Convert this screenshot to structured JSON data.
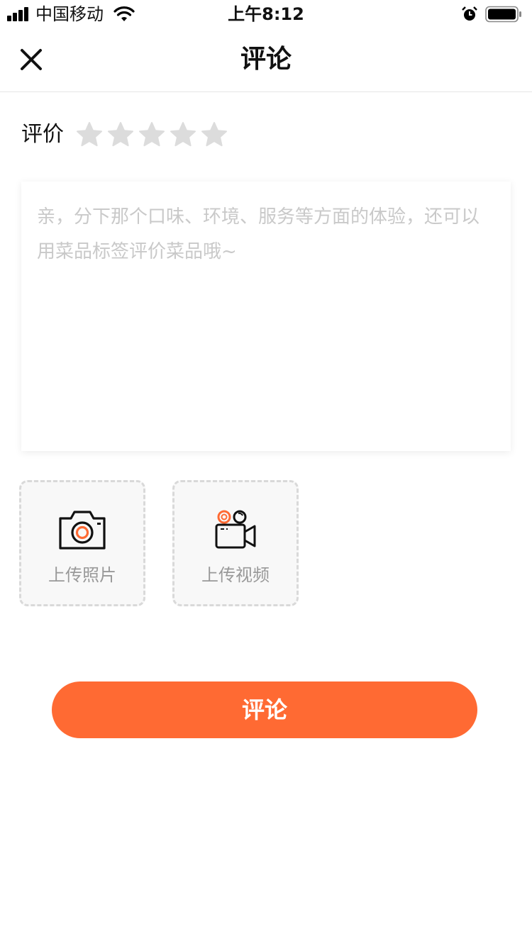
{
  "status_bar": {
    "carrier": "中国移动",
    "time": "上午8:12",
    "signal_icon": "signal-bars-icon",
    "wifi_icon": "wifi-icon",
    "alarm_icon": "alarm-icon",
    "battery_icon": "battery-icon"
  },
  "nav": {
    "title": "评论",
    "close_icon": "close-icon"
  },
  "rating": {
    "label": "评价",
    "max_stars": 5,
    "selected_stars": 0,
    "star_color_inactive": "#dcdcdc"
  },
  "comment": {
    "value": "",
    "placeholder": "亲，分下那个口味、环境、服务等方面的体验，还可以用菜品标签评价菜品哦~"
  },
  "uploads": {
    "photo_label": "上传照片",
    "photo_icon": "camera-icon",
    "video_label": "上传视频",
    "video_icon": "video-camera-icon"
  },
  "submit": {
    "label": "评论",
    "color": "#ff6a33"
  }
}
